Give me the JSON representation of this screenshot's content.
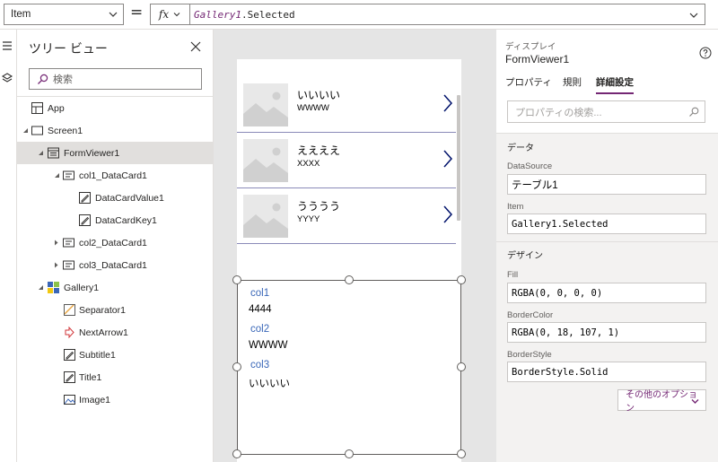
{
  "formula_bar": {
    "property": "Item",
    "fx_label": "fx",
    "formula_fn": "Gallery1",
    "formula_rest": ".Selected"
  },
  "tree": {
    "title": "ツリー ビュー",
    "search_placeholder": "検索",
    "items": [
      {
        "label": "App"
      },
      {
        "label": "Screen1"
      },
      {
        "label": "FormViewer1"
      },
      {
        "label": "col1_DataCard1"
      },
      {
        "label": "DataCardValue1"
      },
      {
        "label": "DataCardKey1"
      },
      {
        "label": "col2_DataCard1"
      },
      {
        "label": "col3_DataCard1"
      },
      {
        "label": "Gallery1"
      },
      {
        "label": "Separator1"
      },
      {
        "label": "NextArrow1"
      },
      {
        "label": "Subtitle1"
      },
      {
        "label": "Title1"
      },
      {
        "label": "Image1"
      }
    ]
  },
  "gallery": {
    "items": [
      {
        "title": "いいいい",
        "subtitle": "WWWW"
      },
      {
        "title": "ええええ",
        "subtitle": "XXXX"
      },
      {
        "title": "うううう",
        "subtitle": "YYYY"
      }
    ]
  },
  "form_viewer": {
    "fields": [
      {
        "label": "col1",
        "value": "4444"
      },
      {
        "label": "col2",
        "value": "WWWW"
      },
      {
        "label": "col3",
        "value": "いいいい"
      }
    ]
  },
  "properties": {
    "kind": "ディスプレイ",
    "name": "FormViewer1",
    "tabs": [
      {
        "label": "プロパティ"
      },
      {
        "label": "規則"
      },
      {
        "label": "詳細設定"
      }
    ],
    "search_placeholder": "プロパティの検索...",
    "data_section": "データ",
    "datasource_label": "DataSource",
    "datasource_value": "テーブル1",
    "item_label": "Item",
    "item_value": "Gallery1.Selected",
    "design_section": "デザイン",
    "fill_label": "Fill",
    "fill_value": "RGBA(0, 0, 0, 0)",
    "bordercolor_label": "BorderColor",
    "bordercolor_value": "RGBA(0, 18, 107, 1)",
    "borderstyle_label": "BorderStyle",
    "borderstyle_value": "BorderStyle.Solid",
    "more_options": "その他のオプション"
  },
  "colors": {
    "accent": "#742774",
    "link_blue": "#3a67b8",
    "arrow_navy": "#00126b"
  }
}
